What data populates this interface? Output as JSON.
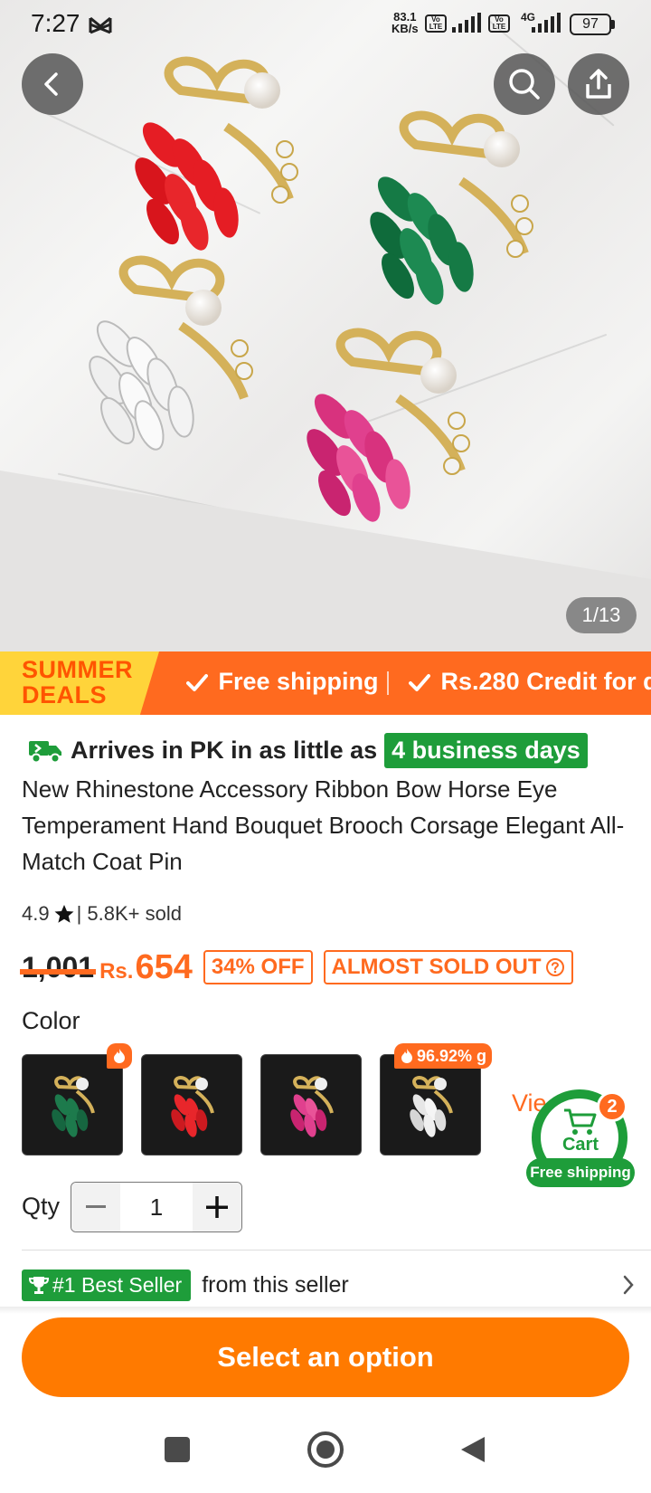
{
  "status_bar": {
    "time": "7:27",
    "speed_value": "83.1",
    "speed_unit": "KB/s",
    "volte_1": "Vo LTE",
    "volte_2": "Vo LTE",
    "network_type": "4G",
    "battery": "97"
  },
  "gallery": {
    "page_indicator": "1/13"
  },
  "promo": {
    "title_line1": "SUMMER",
    "title_line2": "DEALS",
    "item1": "Free shipping",
    "item2": "Rs.280 Credit for d"
  },
  "arrival": {
    "text": "Arrives in PK in as little as",
    "badge": "4 business days"
  },
  "product": {
    "title": "New Rhinestone Accessory Ribbon Bow Horse Eye Temperament Hand Bouquet Brooch Corsage Elegant All-Match Coat Pin",
    "rating": "4.9",
    "sold": "| 5.8K+ sold",
    "original_price": "1,001",
    "currency": "Rs.",
    "price": "654",
    "discount_tag": "34% OFF",
    "stock_tag": "ALMOST SOLD OUT"
  },
  "colors": {
    "label": "Color",
    "options": [
      {
        "name": "Green",
        "color": "#1d7a4c"
      },
      {
        "name": "Red",
        "color": "#e8262b"
      },
      {
        "name": "Pink",
        "color": "#e0408e"
      },
      {
        "name": "White",
        "color": "#e6e6e6"
      }
    ],
    "badge_4": "96.92% g",
    "view_more": "Vie"
  },
  "cart": {
    "count": "2",
    "label": "Cart",
    "shipping": "Free shipping"
  },
  "qty": {
    "label": "Qty",
    "value": "1"
  },
  "seller": {
    "badge": "#1 Best Seller",
    "text": "from this seller"
  },
  "cta": {
    "label": "Select an option"
  },
  "theme": {
    "accent": "#ff6a1f",
    "green": "#1e9d3a"
  }
}
